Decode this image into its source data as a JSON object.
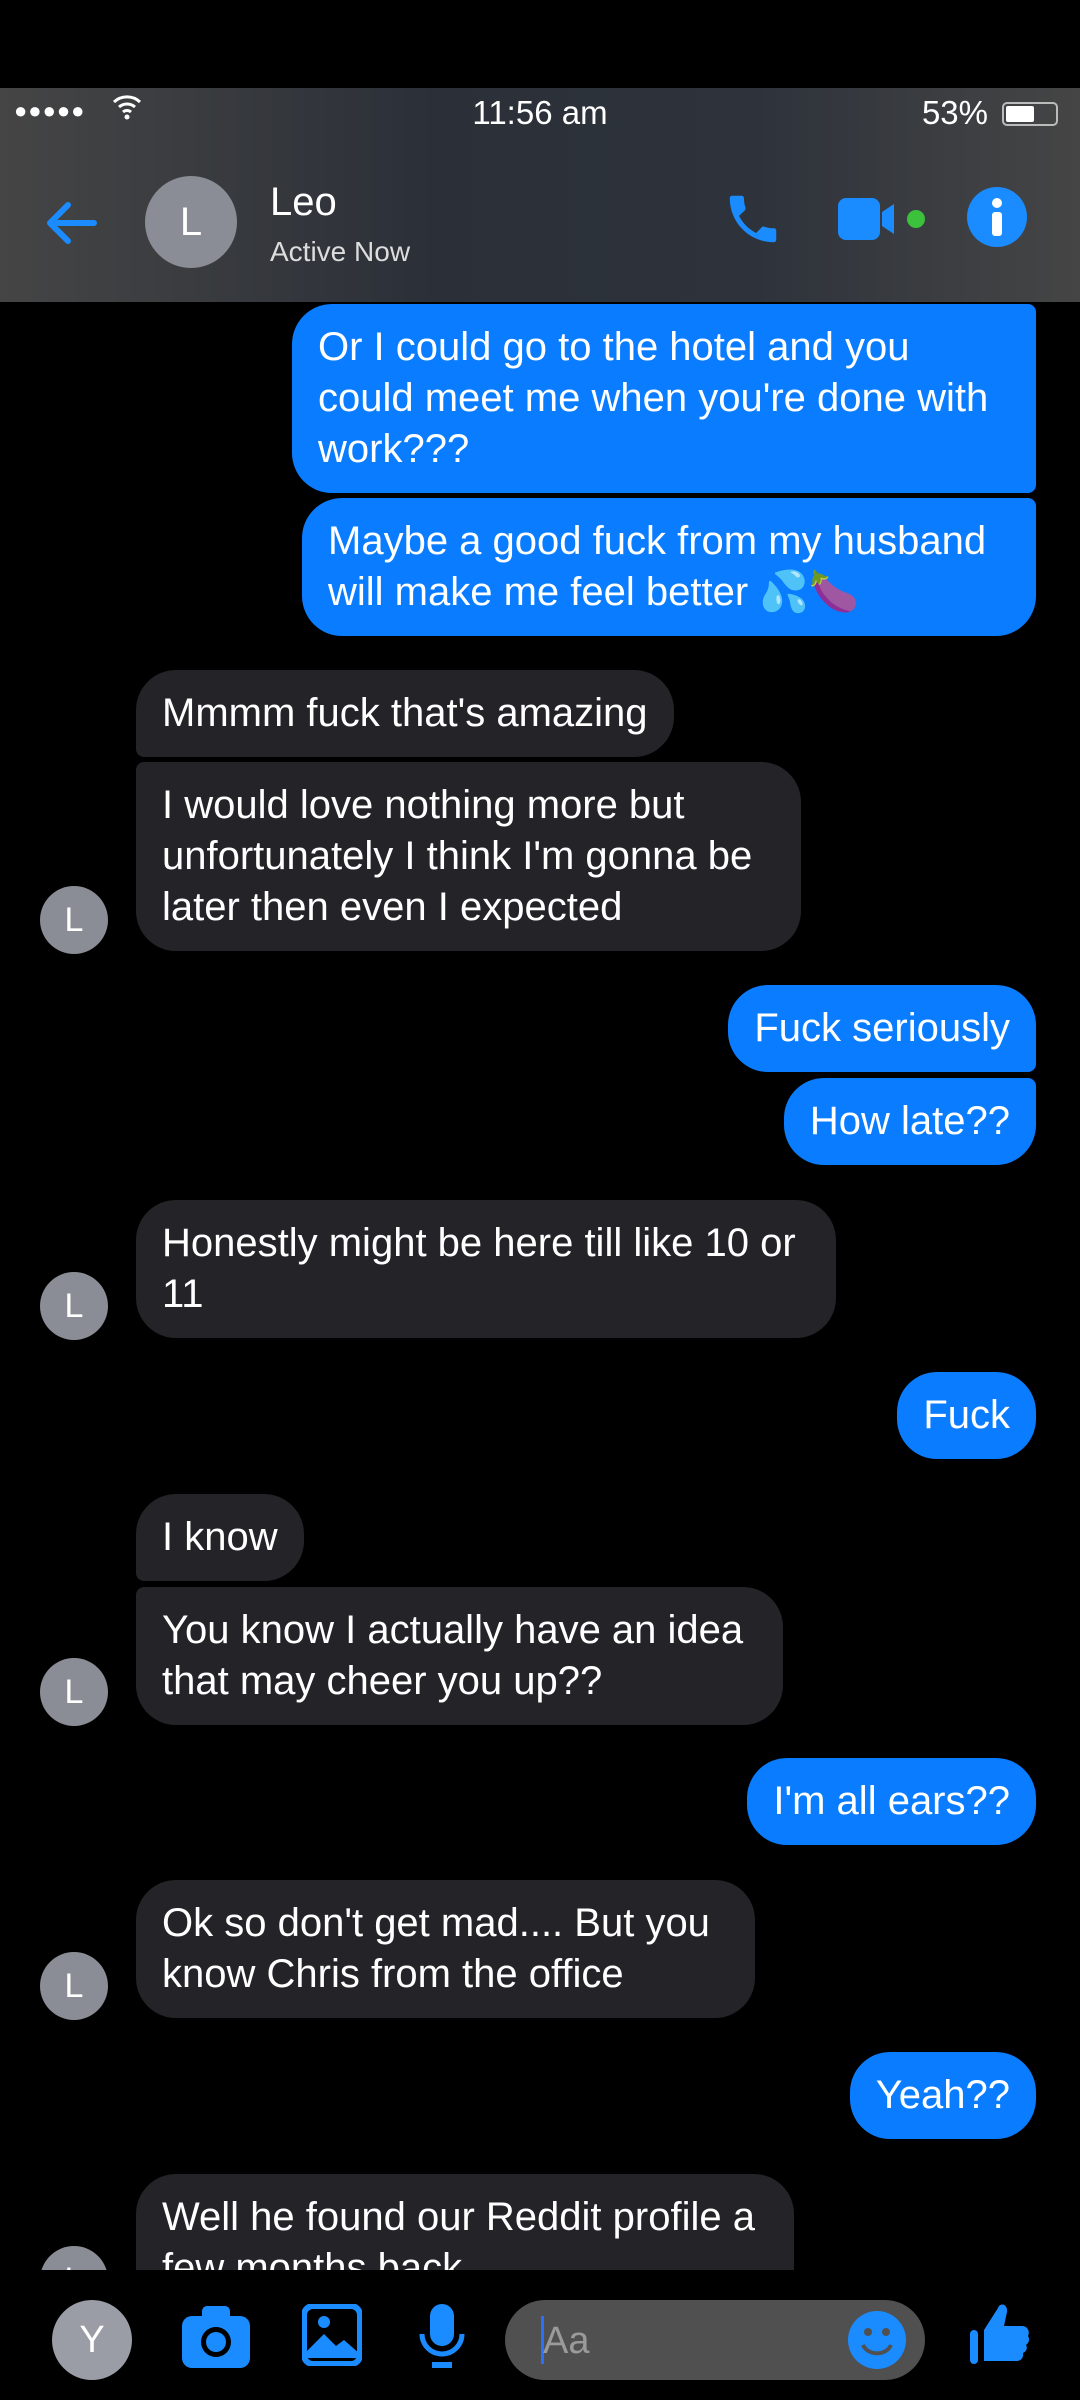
{
  "status": {
    "time": "11:56 am",
    "battery": "53%",
    "signal": "●●●●●",
    "wifi": "wifi-icon"
  },
  "header": {
    "avatar_letter": "L",
    "name": "Leo",
    "status": "Active Now"
  },
  "messages": [
    {
      "from": "me",
      "text": "Or I could go to the hotel and you could meet me when you're done with work???"
    },
    {
      "from": "me",
      "text": "Maybe a good fuck from my husband will make me feel better 💦🍆"
    },
    {
      "from": "them",
      "text": "Mmmm fuck that's amazing"
    },
    {
      "from": "them",
      "text": "I would love nothing more but unfortunately I think I'm gonna be later then even I expected"
    },
    {
      "from": "me",
      "text": "Fuck seriously"
    },
    {
      "from": "me",
      "text": "How late??"
    },
    {
      "from": "them",
      "text": "Honestly might be here till like 10 or 11"
    },
    {
      "from": "me",
      "text": "Fuck"
    },
    {
      "from": "them",
      "text": "I know"
    },
    {
      "from": "them",
      "text": "You know I actually have an idea that may cheer you up??"
    },
    {
      "from": "me",
      "text": "I'm all ears??"
    },
    {
      "from": "them",
      "text": "Ok so don't get mad.... But you know Chris from the office"
    },
    {
      "from": "me",
      "text": "Yeah??"
    },
    {
      "from": "them",
      "text": "Well he found our Reddit profile a few months back"
    }
  ],
  "composer": {
    "avatar_letter": "Y",
    "placeholder": "Aa"
  },
  "theme": {
    "accent": "#0a7cff",
    "incoming": "#242428"
  }
}
